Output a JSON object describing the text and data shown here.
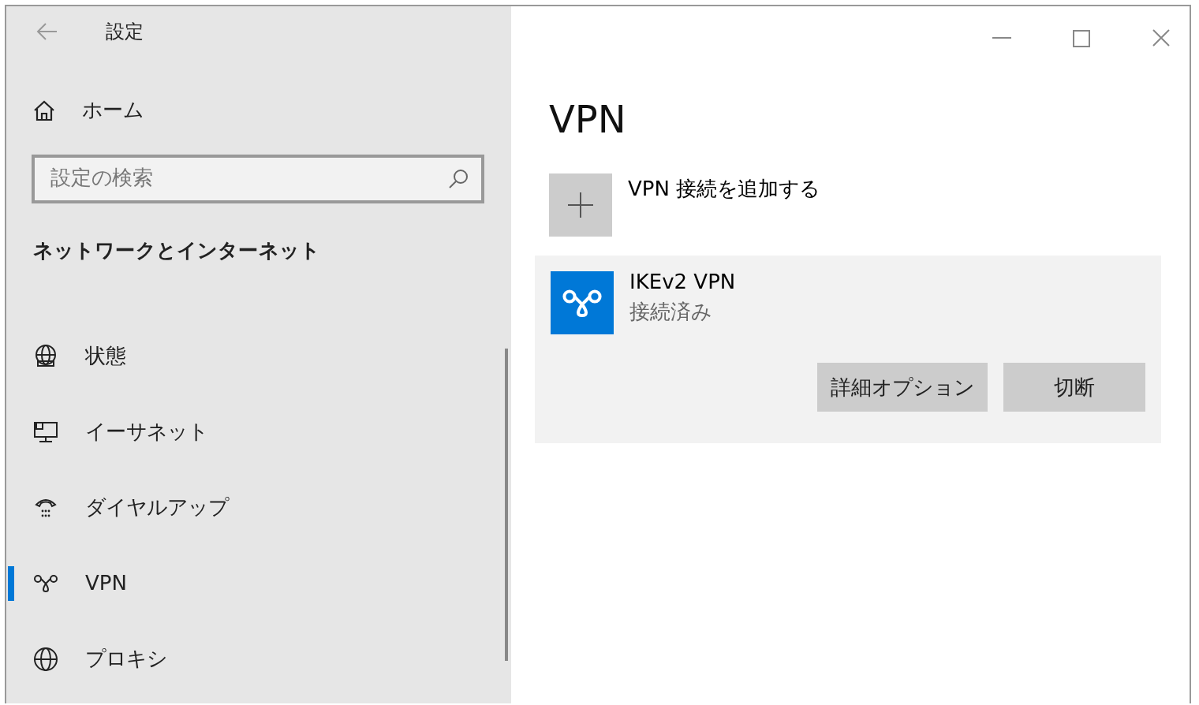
{
  "window": {
    "title": "設定"
  },
  "sidebar": {
    "home": "ホーム",
    "search": {
      "placeholder": "設定の検索"
    },
    "section": "ネットワークとインターネット",
    "items": [
      {
        "label": "状態",
        "kind": "status",
        "selected": false
      },
      {
        "label": "イーサネット",
        "kind": "ethernet",
        "selected": false
      },
      {
        "label": "ダイヤルアップ",
        "kind": "dialup",
        "selected": false
      },
      {
        "label": "VPN",
        "kind": "vpn",
        "selected": true
      },
      {
        "label": "プロキシ",
        "kind": "proxy",
        "selected": false
      }
    ]
  },
  "main": {
    "heading": "VPN",
    "add_label": "VPN 接続を追加する",
    "connections": [
      {
        "name": "IKEv2 VPN",
        "status": "接続済み",
        "buttons": [
          "詳細オプション",
          "切断"
        ]
      }
    ]
  }
}
